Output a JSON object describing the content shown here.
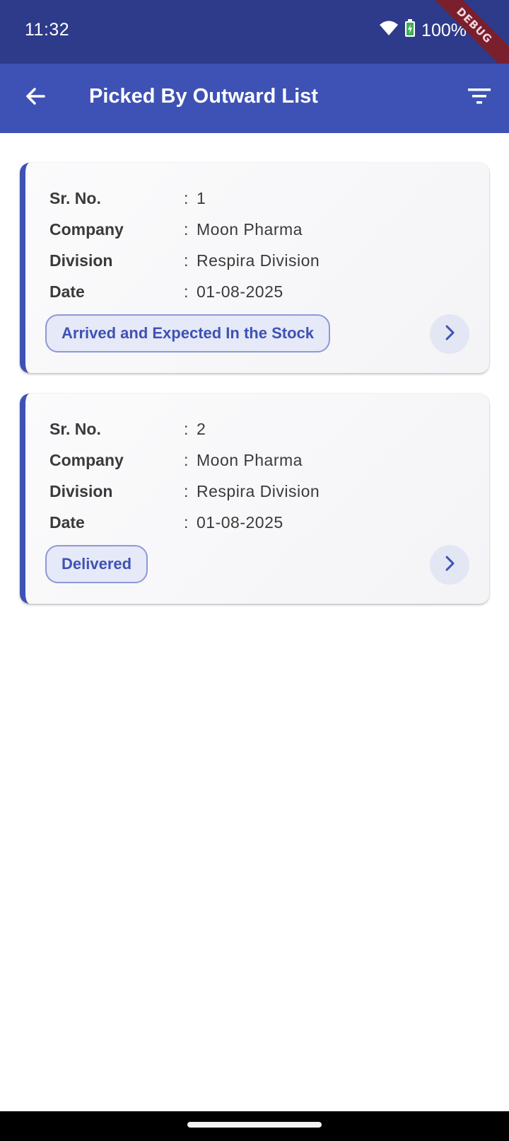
{
  "status_bar": {
    "time": "11:32",
    "battery_percent": "100%",
    "debug_label": "DEBUG"
  },
  "app_bar": {
    "title": "Picked By Outward List",
    "back_icon": "arrow-back-icon",
    "filter_icon": "filter-icon"
  },
  "labels": {
    "sr_no": "Sr. No.",
    "company": "Company",
    "division": "Division",
    "date": "Date",
    "separator": ":"
  },
  "cards": [
    {
      "sr_no": "1",
      "company": "Moon Pharma",
      "division": "Respira Division",
      "date": "01-08-2025",
      "status": "Arrived and Expected In the Stock"
    },
    {
      "sr_no": "2",
      "company": "Moon Pharma",
      "division": "Respira Division",
      "date": "01-08-2025",
      "status": "Delivered"
    }
  ],
  "colors": {
    "status_bar": "#2e3b8a",
    "app_bar": "#3e52b5",
    "accent": "#3e52b5",
    "badge_bg": "#e6e9f7"
  }
}
